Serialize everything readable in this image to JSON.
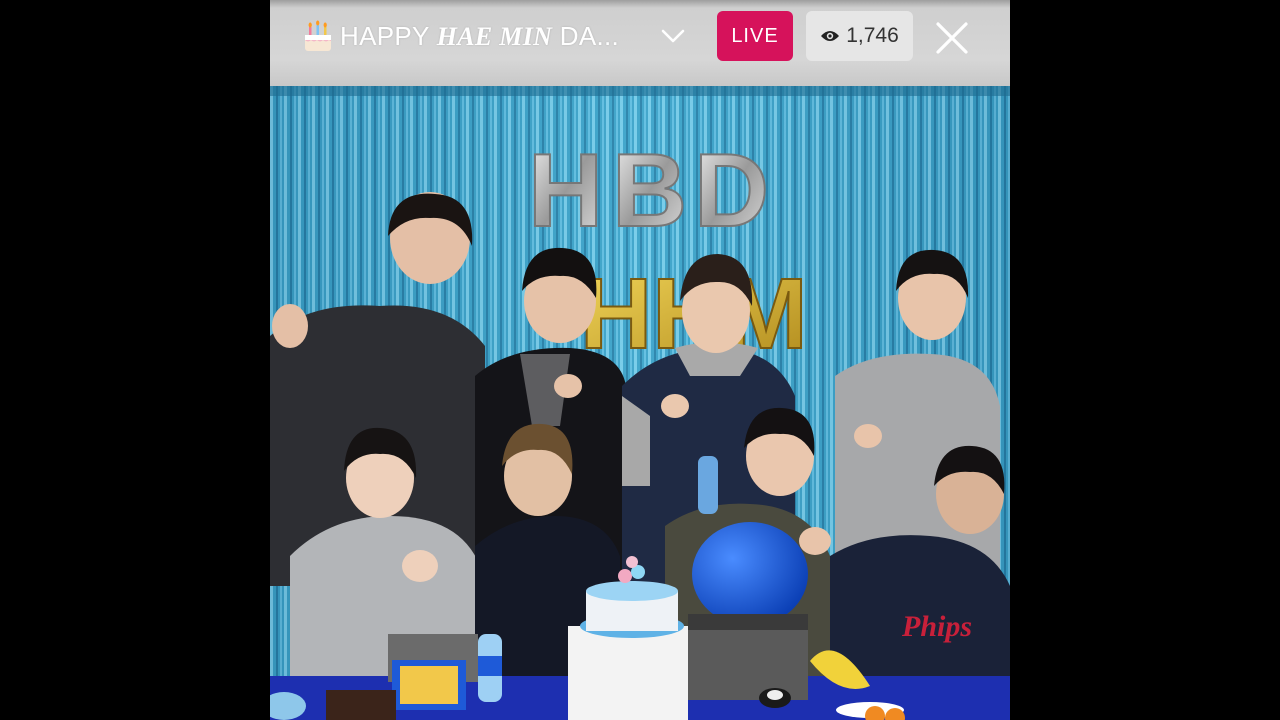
{
  "stream": {
    "title_prefix": "HAPPY ",
    "title_italic": "HAE MIN",
    "title_suffix": " DA...",
    "live_label": "LIVE",
    "viewer_count": "1,746"
  },
  "scene_text": {
    "balloon_letters": [
      "H",
      "B",
      "D"
    ],
    "gold_letters": "HHM",
    "shirt_print": "Phips"
  },
  "icons": {
    "title": "cake-icon",
    "dropdown": "chevron-down-icon",
    "viewers": "eye-icon",
    "close": "close-icon"
  },
  "colors": {
    "live": "#d6125b",
    "header": "#d6d6d6",
    "backdrop": "#3a9fc4"
  }
}
